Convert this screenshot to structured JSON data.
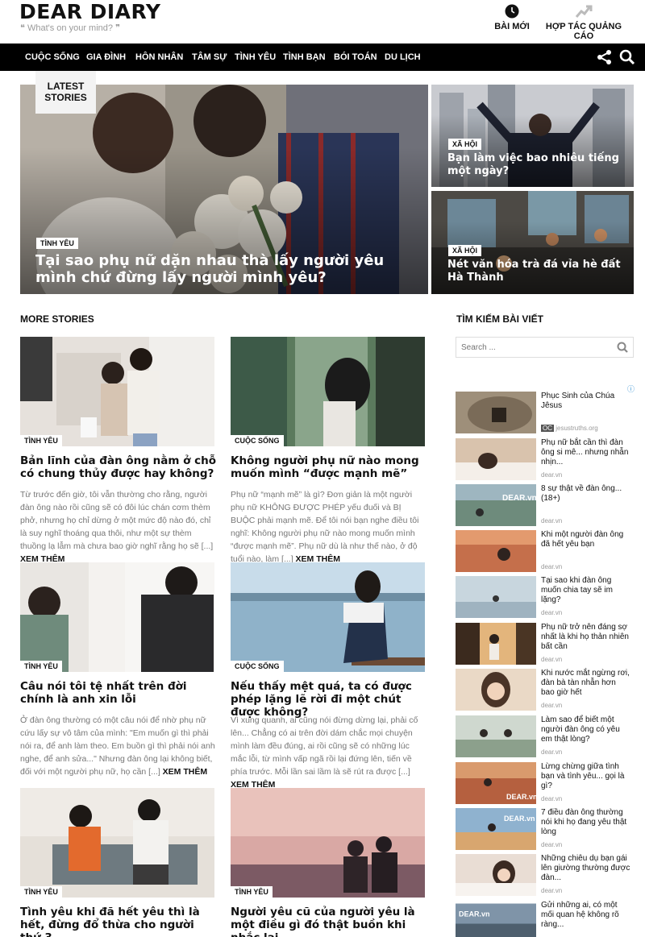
{
  "site": {
    "logo": "DEAR DIARY",
    "tagline": "❝ What's on your mind? ❞"
  },
  "header_links": {
    "new_posts": "BÀI MỚI",
    "ads": "HỢP TÁC QUẢNG CÁO"
  },
  "nav": {
    "items": [
      "CUỘC SỐNG",
      "GIA ĐÌNH",
      "HÔN NHÂN",
      "TÂM SỰ",
      "TÌNH YÊU",
      "TÌNH BẠN",
      "BÓI TOÁN",
      "DU LỊCH"
    ],
    "share_icon": "share-icon",
    "search_icon": "search-icon"
  },
  "featured": {
    "latest_label_1": "LATEST",
    "latest_label_2": "STORIES",
    "main": {
      "category": "TÌNH YÊU",
      "title": "Tại sao phụ nữ dặn nhau thà lấy người yêu mình chứ đừng lấy người mình yêu?"
    },
    "side": [
      {
        "category": "XÃ HỘI",
        "title": "Bạn làm việc bao nhiêu tiếng một ngày?"
      },
      {
        "category": "XÃ HỘI",
        "title": "Nét văn hóa trà đá vỉa hè đất Hà Thành"
      }
    ]
  },
  "more_stories": {
    "heading": "MORE STORIES",
    "read_more": "XEM THÊM",
    "articles": [
      {
        "category": "TÌNH YÊU",
        "title": "Bản lĩnh của đàn ông nằm ở chỗ có chung thủy được hay không?",
        "excerpt": "Từ trước đến giờ, tôi vẫn thường cho rằng, người đàn ông nào rồi cũng sẽ có đôi lúc chán cơm thèm phở, nhưng họ chỉ dừng ở một mức độ nào đó, chỉ là suy nghĩ thoáng qua thôi, như một sự thèm thuồng lạ lẫm mà chưa bao giờ nghĩ rằng họ sẽ [...]"
      },
      {
        "category": "CUỘC SỐNG",
        "title": "Không người phụ nữ nào mong muốn mình “được mạnh mẽ”",
        "excerpt": "Phụ nữ “mạnh mẽ” là gì? Đơn giản là một người phụ nữ KHÔNG ĐƯỢC PHÉP yếu đuối và BỊ BUỘC phải mạnh mẽ. Để tôi nói bạn nghe điều tôi nghĩ: Không người phụ nữ nào mong muốn mình “được mạnh mẽ”. Phụ nữ dù là như thế nào, ở độ tuổi nào, làm [...]"
      },
      {
        "category": "TÌNH YÊU",
        "title": "Câu nói tôi tệ nhất trên đời chính là anh xin lỗi",
        "excerpt": "Ở đàn ông thường có một câu nói để nhờ phụ nữ cứu lấy sự vô tâm của mình: \"Em muốn gì thì phải nói ra, để anh làm theo. Em buồn gì thì phải nói anh nghe, để anh sửa...\" Nhưng đàn ông lại không biết, đối với một người phụ nữ, họ cần [...]"
      },
      {
        "category": "CUỘC SỐNG",
        "title": "Nếu thấy mệt quá, ta có được phép lặng lẽ rời đi một chút được không?",
        "excerpt": "Vì xung quanh, ai cũng nói đừng dừng lại, phải cố lên... Chẳng có ai trên đời dám chắc mọi chuyện mình làm đều đúng, ai rồi cũng sẽ có những lúc mắc lỗi, từ mình vấp ngã rồi lại đứng lên, tiến về phía trước. Mỗi lần sai lầm là sẽ rút ra được [...]"
      },
      {
        "category": "TÌNH YÊU",
        "title": "Tình yêu khi đã hết yêu thì là hết, đừng đổ thừa cho người thứ 3"
      },
      {
        "category": "TÌNH YÊU",
        "title": "Người yêu cũ của người yêu là một điều gì đó thật buồn khi nhắc lại"
      }
    ]
  },
  "sidebar": {
    "search_heading": "TÌM KIẾM BÀI VIẾT",
    "search_placeholder": "Search ...",
    "ad_mark": "ⓘ",
    "ads": [
      {
        "title": "Phục Sinh của Chúa Jêsus",
        "source": "jesustruths.org",
        "badge": "OC"
      },
      {
        "title": "Phụ nữ bắt cần thì đàn ông si mê... nhưng nhẫn nhịn...",
        "source": "dear.vn"
      },
      {
        "title": "8 sự thật về đàn ông... (18+)",
        "source": "dear.vn",
        "img_label": "DEAR.vn"
      },
      {
        "title": "Khi một người đàn ông đã hết yêu bạn",
        "source": "dear.vn"
      },
      {
        "title": "Tại sao khi đàn ông muốn chia tay sẽ im lặng?",
        "source": "dear.vn"
      },
      {
        "title": "Phụ nữ trở nên đáng sợ nhất là khi họ thản nhiên bất cần",
        "source": "dear.vn"
      },
      {
        "title": "Khi nước mắt ngừng rơi, đàn bà tàn nhẫn hơn bao giờ hết",
        "source": "dear.vn"
      },
      {
        "title": "Làm sao để biết một người đàn ông có yêu em thật lòng?",
        "source": "dear.vn"
      },
      {
        "title": "Lừng chừng giữa tình bạn và tình yêu... gọi là gì?",
        "source": "dear.vn",
        "img_label": "DEAR.vn"
      },
      {
        "title": "7 điều đàn ông thường nói khi họ đang yêu thật lòng",
        "source": "dear.vn",
        "img_label": "DEAR.vn"
      },
      {
        "title": "Những chiêu dụ bạn gái lên giường thường được đàn...",
        "source": "dear.vn"
      },
      {
        "title": "Gửi những ai, có một mối quan hệ không rõ ràng...",
        "source": "dear.vn",
        "img_label": "DEAR.vn"
      }
    ]
  }
}
